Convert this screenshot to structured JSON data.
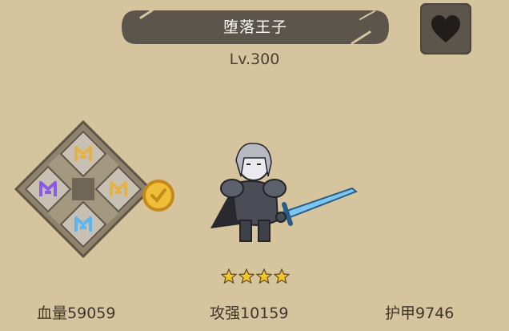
{
  "hero": {
    "name": "堕落王子",
    "level": "Lv.300",
    "star_count": 4,
    "max_stars": 4
  },
  "stats": {
    "hp": {
      "label": "血量",
      "value": "59059"
    },
    "atk": {
      "label": "攻强",
      "value": "10159"
    },
    "def": {
      "label": "护甲",
      "value": "9746"
    }
  },
  "runes": {
    "top": "gold-rune-icon",
    "left": "purple-rune-icon",
    "right": "gold-rune-icon",
    "bottom": "blue-rune-icon",
    "center": "empty"
  },
  "icons": {
    "favorite": "heart-icon",
    "upgrade_coin": "gold-coin-icon"
  },
  "colors": {
    "background": "#d6c49f",
    "banner": "#5b554c",
    "rune_gold": "#e3b24a",
    "rune_purple": "#8a5be0",
    "rune_blue": "#5cb6f0",
    "star": "#f2c62b"
  }
}
